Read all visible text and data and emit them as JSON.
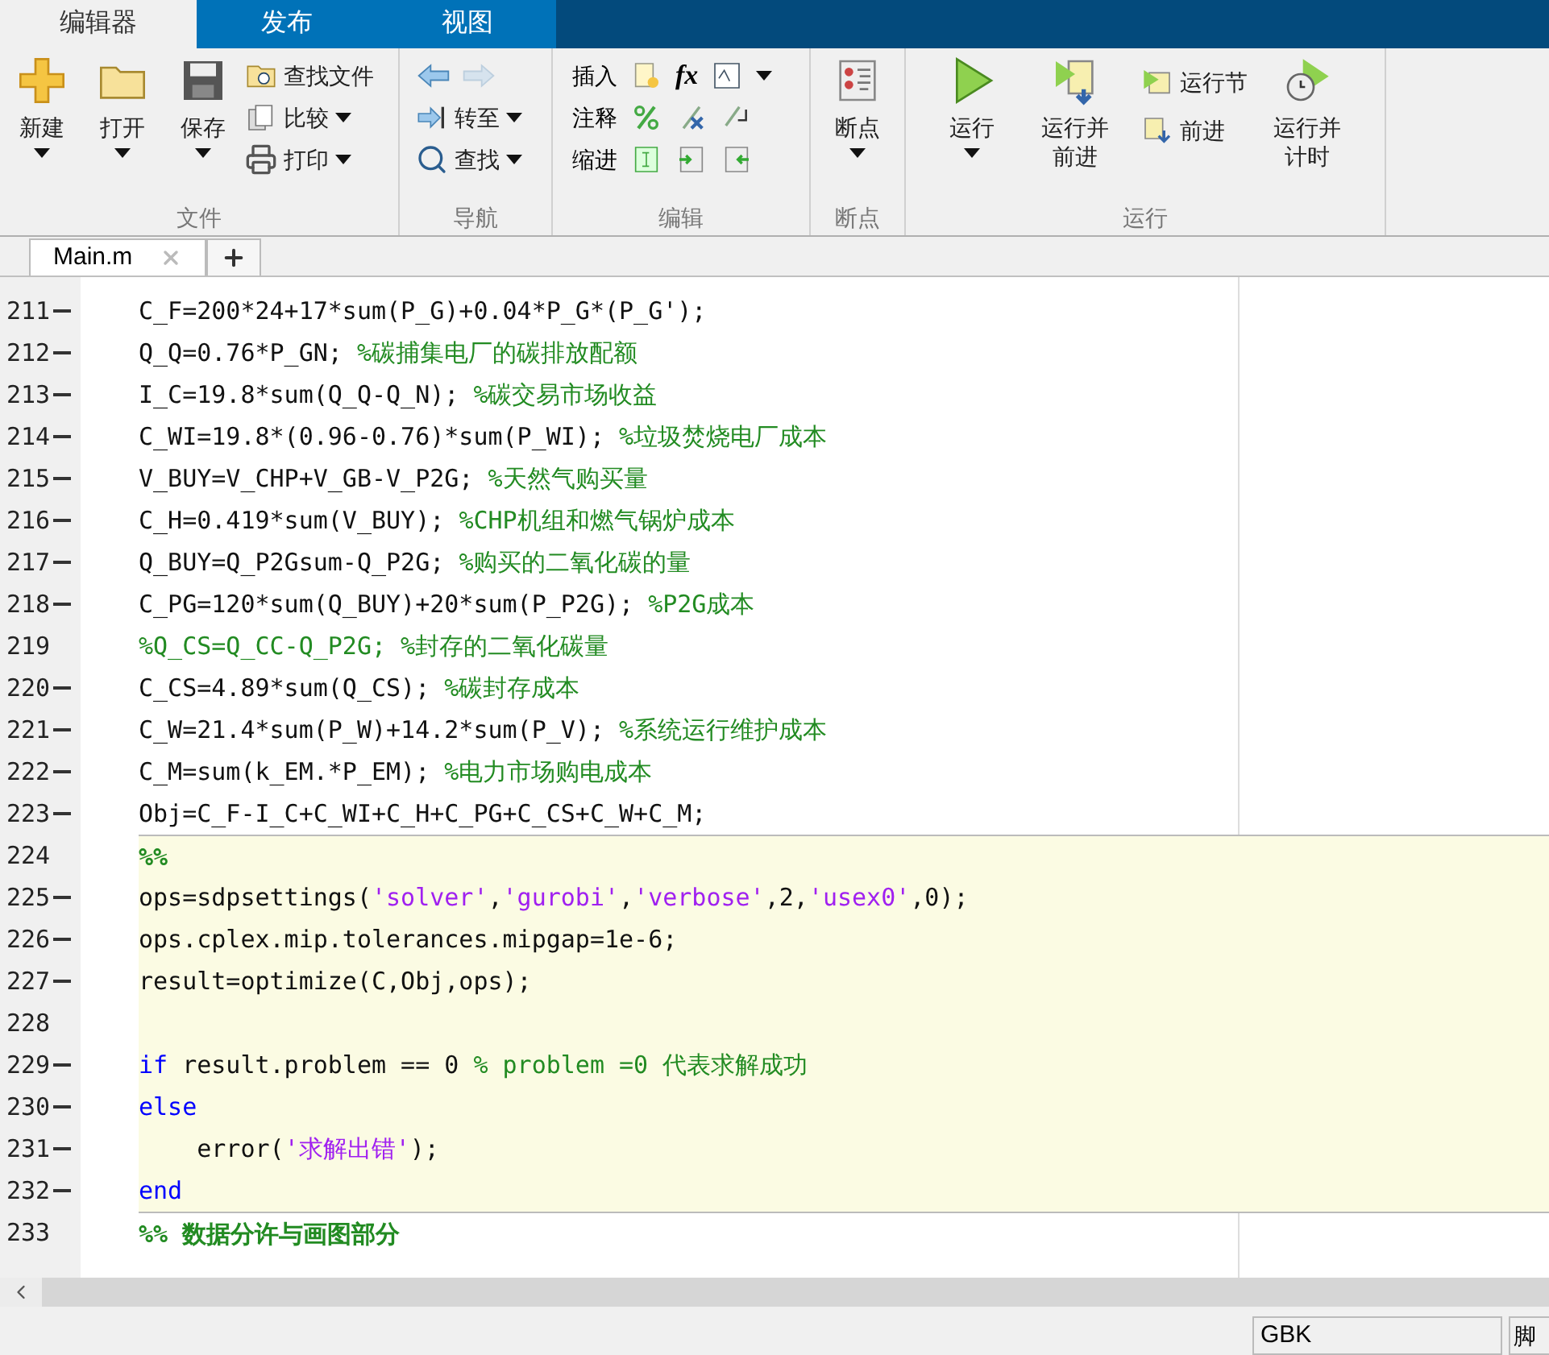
{
  "tabs": [
    {
      "label": "编辑器",
      "selected": true
    },
    {
      "label": "发布",
      "selected": false
    },
    {
      "label": "视图",
      "selected": false
    }
  ],
  "ribbon": {
    "file": {
      "title": "文件",
      "new": "新建",
      "open": "打开",
      "save": "保存",
      "find_files": "查找文件",
      "compare": "比较",
      "print": "打印"
    },
    "navigate": {
      "title": "导航",
      "back": {
        "disabled": false
      },
      "forward": {
        "disabled": true
      },
      "go_to": "转至",
      "find": "查找"
    },
    "edit": {
      "title": "编辑",
      "insert": "插入",
      "function_symbol": "fx",
      "comment": "注释",
      "indent": "缩进"
    },
    "breakpoints": {
      "title": "断点",
      "breakpoints": "断点"
    },
    "run": {
      "title": "运行",
      "run": "运行",
      "run_and_advance": "运行并前进",
      "run_section": "运行节",
      "advance": "前进",
      "run_and_time": "运行并计时"
    }
  },
  "editor_tabs": [
    {
      "label": "Main.m",
      "selected": true
    }
  ],
  "lines": [
    {
      "number": "211",
      "executable": true,
      "in_cell": false,
      "tokens": [
        {
          "kind": "code",
          "text": "C_F=200*24+17*sum(P_G)+0.04*P_G*(P_G');"
        }
      ]
    },
    {
      "number": "212",
      "executable": true,
      "in_cell": false,
      "tokens": [
        {
          "kind": "code",
          "text": "Q_Q=0.76*P_GN; "
        },
        {
          "kind": "comment",
          "text": "%碳捕集电厂的碳排放配额"
        }
      ]
    },
    {
      "number": "213",
      "executable": true,
      "in_cell": false,
      "tokens": [
        {
          "kind": "code",
          "text": "I_C=19.8*sum(Q_Q-Q_N); "
        },
        {
          "kind": "comment",
          "text": "%碳交易市场收益"
        }
      ]
    },
    {
      "number": "214",
      "executable": true,
      "in_cell": false,
      "tokens": [
        {
          "kind": "code",
          "text": "C_WI=19.8*(0.96-0.76)*sum(P_WI); "
        },
        {
          "kind": "comment",
          "text": "%垃圾焚烧电厂成本"
        }
      ]
    },
    {
      "number": "215",
      "executable": true,
      "in_cell": false,
      "tokens": [
        {
          "kind": "code",
          "text": "V_BUY=V_CHP+V_GB-V_P2G; "
        },
        {
          "kind": "comment",
          "text": "%天然气购买量"
        }
      ]
    },
    {
      "number": "216",
      "executable": true,
      "in_cell": false,
      "tokens": [
        {
          "kind": "code",
          "text": "C_H=0.419*sum(V_BUY); "
        },
        {
          "kind": "comment",
          "text": "%CHP机组和燃气锅炉成本"
        }
      ]
    },
    {
      "number": "217",
      "executable": true,
      "in_cell": false,
      "tokens": [
        {
          "kind": "code",
          "text": "Q_BUY=Q_P2Gsum-Q_P2G; "
        },
        {
          "kind": "comment",
          "text": "%购买的二氧化碳的量"
        }
      ]
    },
    {
      "number": "218",
      "executable": true,
      "in_cell": false,
      "tokens": [
        {
          "kind": "code",
          "text": "C_PG=120*sum(Q_BUY)+20*sum(P_P2G); "
        },
        {
          "kind": "comment",
          "text": "%P2G成本"
        }
      ]
    },
    {
      "number": "219",
      "executable": false,
      "in_cell": false,
      "tokens": [
        {
          "kind": "comment",
          "text": "%Q_CS=Q_CC-Q_P2G; %封存的二氧化碳量"
        }
      ]
    },
    {
      "number": "220",
      "executable": true,
      "in_cell": false,
      "tokens": [
        {
          "kind": "code",
          "text": "C_CS=4.89*sum(Q_CS); "
        },
        {
          "kind": "comment",
          "text": "%碳封存成本"
        }
      ]
    },
    {
      "number": "221",
      "executable": true,
      "in_cell": false,
      "tokens": [
        {
          "kind": "code",
          "text": "C_W=21.4*sum(P_W)+14.2*sum(P_V); "
        },
        {
          "kind": "comment",
          "text": "%系统运行维护成本"
        }
      ]
    },
    {
      "number": "222",
      "executable": true,
      "in_cell": false,
      "tokens": [
        {
          "kind": "code",
          "text": "C_M=sum(k_EM.*P_EM); "
        },
        {
          "kind": "comment",
          "text": "%电力市场购电成本"
        }
      ]
    },
    {
      "number": "223",
      "executable": true,
      "in_cell": false,
      "tokens": [
        {
          "kind": "code",
          "text": "Obj=C_F-I_C+C_WI+C_H+C_PG+C_CS+C_W+C_M;"
        }
      ]
    },
    {
      "number": "224",
      "executable": false,
      "in_cell": true,
      "tokens": [
        {
          "kind": "cell",
          "text": "%%"
        }
      ]
    },
    {
      "number": "225",
      "executable": true,
      "in_cell": true,
      "tokens": [
        {
          "kind": "code",
          "text": "ops=sdpsettings("
        },
        {
          "kind": "string",
          "text": "'solver'"
        },
        {
          "kind": "code",
          "text": ","
        },
        {
          "kind": "string",
          "text": "'gurobi'"
        },
        {
          "kind": "code",
          "text": ","
        },
        {
          "kind": "string",
          "text": "'verbose'"
        },
        {
          "kind": "code",
          "text": ",2,"
        },
        {
          "kind": "string",
          "text": "'usex0'"
        },
        {
          "kind": "code",
          "text": ",0);"
        }
      ]
    },
    {
      "number": "226",
      "executable": true,
      "in_cell": true,
      "tokens": [
        {
          "kind": "code",
          "text": "ops.cplex.mip.tolerances.mipgap=1e-6;"
        }
      ]
    },
    {
      "number": "227",
      "executable": true,
      "in_cell": true,
      "tokens": [
        {
          "kind": "code",
          "text": "result=optimize(C,Obj,ops);"
        }
      ]
    },
    {
      "number": "228",
      "executable": false,
      "in_cell": true
    },
    {
      "number": "229",
      "executable": true,
      "in_cell": true,
      "tokens": [
        {
          "kind": "keyword",
          "text": "if"
        },
        {
          "kind": "code",
          "text": " result.problem == 0 "
        },
        {
          "kind": "comment",
          "text": "% problem =0 代表求解成功"
        }
      ]
    },
    {
      "number": "230",
      "executable": true,
      "in_cell": true,
      "tokens": [
        {
          "kind": "keyword",
          "text": "else"
        }
      ]
    },
    {
      "number": "231",
      "executable": true,
      "in_cell": true,
      "tokens": [
        {
          "kind": "code",
          "text": "    error("
        },
        {
          "kind": "string",
          "text": "'求解出错'"
        },
        {
          "kind": "code",
          "text": ");"
        }
      ]
    },
    {
      "number": "232",
      "executable": true,
      "in_cell": true,
      "tokens": [
        {
          "kind": "keyword",
          "text": "end"
        }
      ]
    },
    {
      "number": "233",
      "executable": false,
      "in_cell": false,
      "tokens": [
        {
          "kind": "cell",
          "text": "%% 数据分许与画图部分"
        }
      ]
    }
  ],
  "status_bar": {
    "encoding": "GBK",
    "type": "脚"
  }
}
